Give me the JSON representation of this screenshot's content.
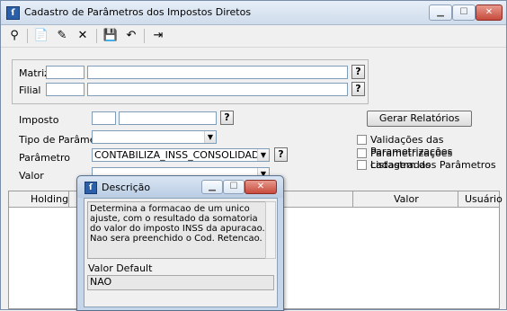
{
  "window": {
    "title": "Cadastro de Parâmetros dos Impostos Diretos",
    "controls": [
      "minimize",
      "maximize",
      "close"
    ]
  },
  "toolbar": {
    "icons": [
      "binoculars-icon",
      "new-doc-icon",
      "edit-icon",
      "delete-icon",
      "save-icon",
      "undo-icon",
      "exit-icon"
    ]
  },
  "filter": {
    "matriz_label": "Matriz",
    "filial_label": "Filial",
    "matriz_code": "",
    "matriz_name": "",
    "filial_code": "",
    "filial_name": "",
    "lookup_label": "?"
  },
  "form": {
    "imposto_label": "Imposto",
    "imposto_code": "",
    "imposto_name": "",
    "tipo_label": "Tipo de Parâmetro",
    "tipo_value": "",
    "parametro_label": "Parâmetro",
    "parametro_value": "CONTABILIZA_INSS_CONSOLIDADO",
    "valor_label": "Valor",
    "valor_value": "",
    "lookup_label": "?"
  },
  "reports": {
    "button_label": "Gerar Relatórios",
    "checkboxes": [
      {
        "label": "Validações das Parametrizações",
        "checked": false
      },
      {
        "label": "Parametrizações cadastradas",
        "checked": false
      },
      {
        "label": "Listagem dos Parâmetros",
        "checked": false
      }
    ]
  },
  "grid": {
    "columns": [
      "Holding",
      "Valor",
      "Usuário"
    ]
  },
  "dialog": {
    "title": "Descrição",
    "description": "Determina a formacao de um unico ajuste, com o resultado da somatoria do valor do imposto INSS da apuracao. Nao sera preenchido o Cod. Retencao.",
    "default_label": "Valor Default",
    "default_value": "NAO"
  }
}
